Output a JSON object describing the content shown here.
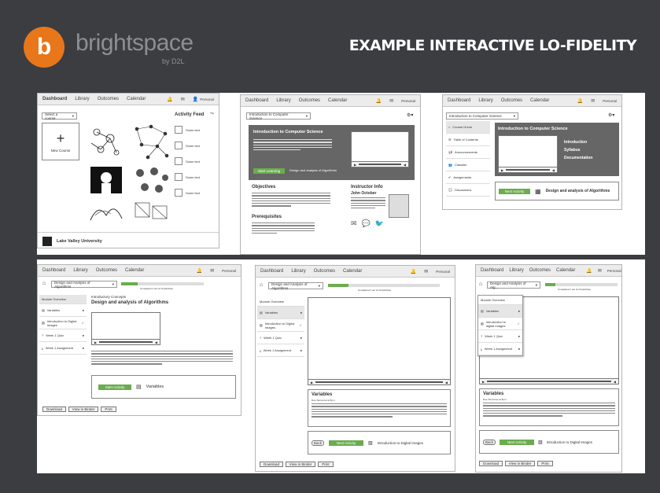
{
  "header": {
    "logo_letter": "b",
    "brand": "brightspace",
    "brand_sub": "by D2L",
    "headline": "EXAMPLE INTERACTIVE LO-FIDELITY"
  },
  "nav": {
    "dashboard": "Dashboard",
    "library": "Library",
    "outcomes": "Outcomes",
    "calendar": "Calendar",
    "personal": "Personal"
  },
  "panel1": {
    "select": "Select a course",
    "activity_feed": "Activity Feed",
    "new_course": "New Course",
    "feed_items": [
      "Some text",
      "Some text",
      "Some text",
      "Some text",
      "Some text"
    ],
    "university": "Lake Valley University"
  },
  "panel2": {
    "select": "Introduction to Computer Science",
    "banner_title": "Introduction to Computer Science",
    "start_learning": "Start Learning",
    "start_text": "Design and analysis of Algorithms",
    "objectives": "Objectives",
    "prerequisites": "Prerequisites",
    "instructor_info": "Instructor Info",
    "instructor_name": "John October"
  },
  "panel3": {
    "select": "Introduction to Computer Science",
    "banner_title": "Introduction to Computer Science",
    "menu": [
      "Introduction",
      "Syllabus",
      "Documentation"
    ],
    "side": [
      "Course Home",
      "Table of Contents",
      "Announcements",
      "Classlist",
      "Assignments",
      "Discussions"
    ],
    "next_activity": "Next Activity",
    "next_text": "Design and analysis of Algorithms"
  },
  "panel4": {
    "select": "Design and Analysis of Algorithms",
    "progress": "Completed 1 out of 10 activities",
    "module_overview": "Module Overview",
    "side": [
      "Variables",
      "Introduction to Digital Images",
      "Week 1 Quiz",
      "Week 1 Assignment"
    ],
    "concept_small": "Introductory Concepts",
    "concept_title": "Design and analysis of Algorithms",
    "start_activity": "Start Activity",
    "activity_name": "Variables",
    "download": "Download",
    "binder": "View in Binder",
    "print": "Print"
  },
  "panel5": {
    "select": "Design and Analysis of Algorithms",
    "progress": "Completed 1 out of 10 activities",
    "module_overview": "Module Overview",
    "side": [
      "Variables",
      "Introduction to Digital Images",
      "Week 1 Quiz",
      "Week 1 Assignment"
    ],
    "variables": "Variables",
    "variables_sub": "Due Tomorrow at 5pm",
    "back": "Back",
    "next_activity": "Next Activity",
    "next_text": "Introduction to Digital Images",
    "download": "Download",
    "binder": "View in Binder",
    "print": "Print"
  },
  "panel6": {
    "select": "Design and Analysis of Alg...",
    "progress": "Completed 1 out of 10 activities",
    "module_overview": "Module Overview",
    "side": [
      "Variables",
      "Introduction to digital Images",
      "Week 1 Quiz",
      "Week 1 Assignment"
    ],
    "variables": "Variables",
    "variables_sub": "Due Tomorrow at 5pm",
    "back": "Back",
    "next_activity": "Next Activity",
    "next_text": "Introduction to Digital Images",
    "download": "Download",
    "binder": "View in Binder",
    "print": "Print"
  }
}
